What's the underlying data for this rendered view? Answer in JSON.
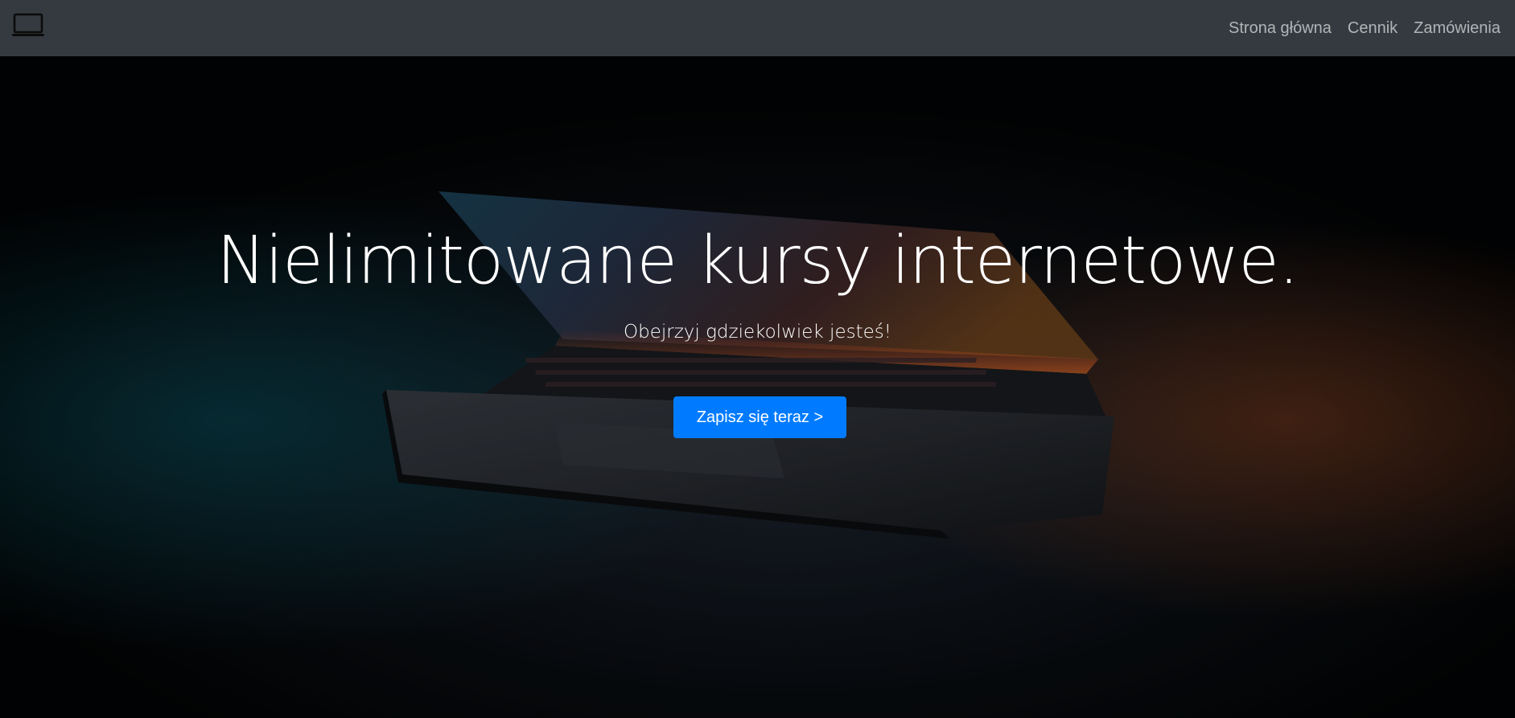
{
  "navbar": {
    "brand_icon": "laptop-icon",
    "links": [
      {
        "label": "Strona główna"
      },
      {
        "label": "Cennik"
      },
      {
        "label": "Zamówienia"
      }
    ]
  },
  "hero": {
    "title": "Nielimitowane kursy internetowe.",
    "subtitle": "Obejrzyj gdziekolwiek jesteś!",
    "cta_label": "Zapisz się teraz >",
    "background": "dark laptop photo"
  },
  "colors": {
    "navbar_bg": "#343a40",
    "nav_link": "#9a9da1",
    "cta_bg": "#007bff",
    "text": "#ffffff"
  }
}
